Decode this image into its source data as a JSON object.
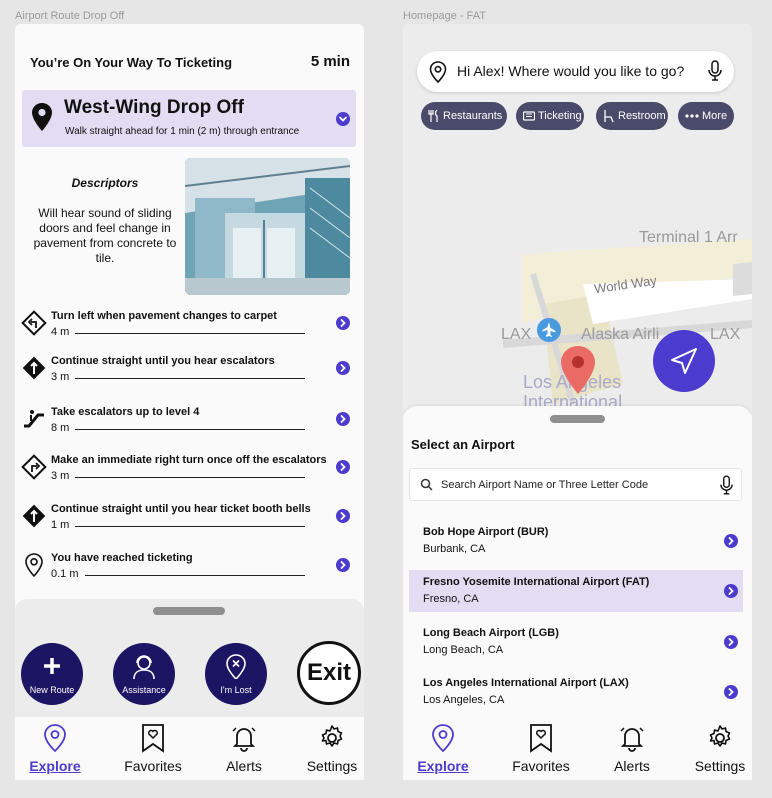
{
  "frames": {
    "left_label": "Airport Route Drop Off",
    "right_label": "Homepage - FAT"
  },
  "route": {
    "header_title": "You’re On Your Way To Ticketing",
    "eta": "5 min",
    "dropoff_name": "West-Wing Drop Off",
    "dropoff_instruction": "Walk straight ahead for 1 min (2 m) through entrance",
    "descriptors_title": "Descriptors",
    "descriptors_text": "Will hear sound of sliding doors and feel change in pavement from concrete to tile."
  },
  "steps": [
    {
      "text": "Turn left when pavement changes to carpet",
      "distance": "4 m",
      "icon": "turn-left-sign-icon"
    },
    {
      "text": "Continue straight until you hear escalators",
      "distance": "3 m",
      "icon": "straight-sign-icon"
    },
    {
      "text": "Take escalators up to level 4",
      "distance": "8 m",
      "icon": "escalator-icon"
    },
    {
      "text": "Make an immediate right turn once off the escalators",
      "distance": "3 m",
      "icon": "turn-right-sign-icon"
    },
    {
      "text": "Continue straight until you hear ticket booth bells",
      "distance": "1 m",
      "icon": "straight-sign-icon"
    },
    {
      "text": "You have reached ticketing",
      "distance": "0.1 m",
      "icon": "location-pin-icon"
    }
  ],
  "actions": {
    "new_route": "New Route",
    "assistance": "Assistance",
    "lost": "I'm Lost",
    "exit": "Exit"
  },
  "tabs": [
    {
      "label": "Explore",
      "active": true
    },
    {
      "label": "Favorites",
      "active": false
    },
    {
      "label": "Alerts",
      "active": false
    },
    {
      "label": "Settings",
      "active": false
    }
  ],
  "home": {
    "greeting": "Hi Alex! Where would you like to go?",
    "chips": [
      "Restaurants",
      "Ticketing",
      "Restroom",
      "More"
    ],
    "map_labels": {
      "terminal": "Terminal 1 Arr",
      "road": "World Way",
      "lax1": "LAX",
      "alaska": "Alaska Airli",
      "lax2": "LAX",
      "la": "Los Angeles",
      "intl": "International"
    },
    "select_title": "Select an Airport",
    "search_placeholder": "Search Airport Name or Three Letter Code",
    "airports": [
      {
        "name": "Bob Hope Airport (BUR)",
        "city": "Burbank, CA",
        "selected": false
      },
      {
        "name": "Fresno Yosemite International Airport (FAT)",
        "city": "Fresno, CA",
        "selected": true
      },
      {
        "name": "Long Beach Airport (LGB)",
        "city": "Long Beach, CA",
        "selected": false
      },
      {
        "name": "Los Angeles International Airport (LAX)",
        "city": "Los Angeles, CA",
        "selected": false
      }
    ]
  },
  "colors": {
    "accent": "#4c3bcf",
    "highlight": "#e2ddf3",
    "action_button": "#1c1563",
    "chip": "#4a4a6b"
  }
}
